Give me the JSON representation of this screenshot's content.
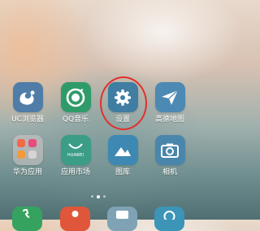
{
  "apps": [
    {
      "id": "uc",
      "label": "UC浏览器",
      "icon": "uc-browser-icon"
    },
    {
      "id": "qq",
      "label": "QQ音乐",
      "icon": "qq-music-icon"
    },
    {
      "id": "settings",
      "label": "设置",
      "icon": "gear-icon"
    },
    {
      "id": "map",
      "label": "高德地图",
      "icon": "paper-plane-icon"
    },
    {
      "id": "huawei",
      "label": "华为应用",
      "icon": "app-folder-icon"
    },
    {
      "id": "market",
      "label": "应用市场",
      "icon": "shopping-bag-icon"
    },
    {
      "id": "gallery",
      "label": "图库",
      "icon": "mountain-image-icon"
    },
    {
      "id": "camera",
      "label": "相机",
      "icon": "camera-icon"
    }
  ],
  "market_icon_text": "HUAWEI",
  "colors": {
    "highlight": "#e0312e"
  },
  "pager": {
    "pages": 3,
    "current": 2
  }
}
